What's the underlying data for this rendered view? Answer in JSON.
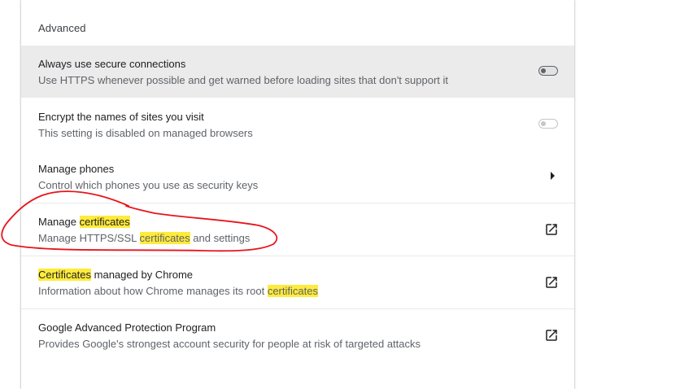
{
  "section": {
    "title": "Advanced"
  },
  "rows": [
    {
      "title": "Always use secure connections",
      "sub": "Use HTTPS whenever possible and get warned before loading sites that don't support it",
      "control": "toggle",
      "state": "off"
    },
    {
      "title": "Encrypt the names of sites you visit",
      "sub": "This setting is disabled on managed browsers",
      "control": "toggle",
      "state": "off-disabled"
    },
    {
      "title": "Manage phones",
      "sub": "Control which phones you use as security keys",
      "control": "arrow-right-icon"
    },
    {
      "title_pre": "Manage ",
      "title_hl": "certificates",
      "sub_pre": "Manage HTTPS/SSL ",
      "sub_hl": "certificates",
      "sub_post": " and settings",
      "control": "open-in-new-icon"
    },
    {
      "title_hl": "Certificates",
      "title_post": " managed by Chrome",
      "sub_pre": "Information about how Chrome manages its root ",
      "sub_hl": "certificates",
      "control": "open-in-new-icon"
    },
    {
      "title": "Google Advanced Protection Program",
      "sub": "Provides Google's strongest account security for people at risk of targeted attacks",
      "control": "open-in-new-icon"
    }
  ],
  "colors": {
    "highlight": "#ffeb3b",
    "hover_row": "#ebebeb",
    "annotation": "#e8141c"
  }
}
